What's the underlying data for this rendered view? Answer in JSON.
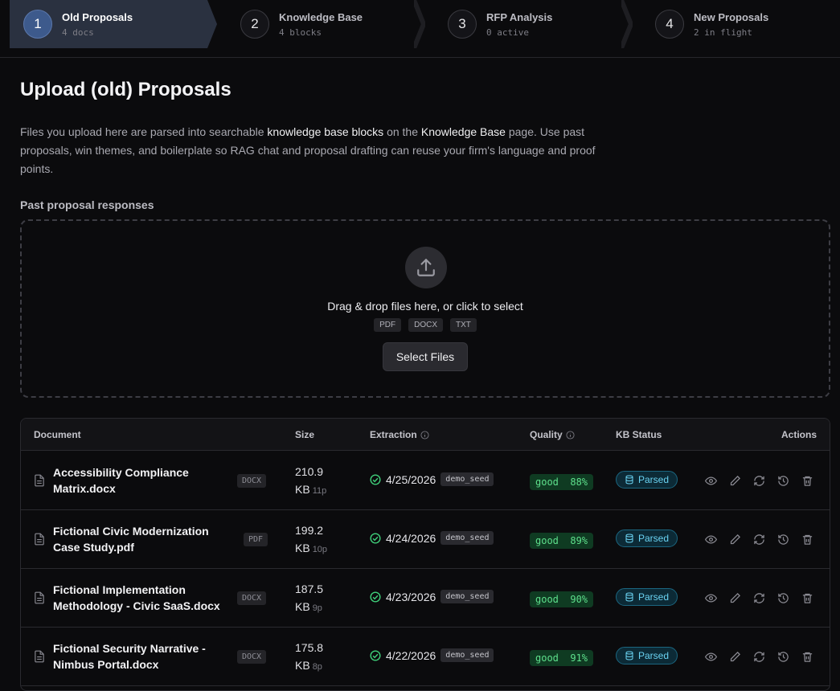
{
  "steps": [
    {
      "num": "1",
      "title": "Old Proposals",
      "sub": "4 docs"
    },
    {
      "num": "2",
      "title": "Knowledge Base",
      "sub": "4 blocks"
    },
    {
      "num": "3",
      "title": "RFP Analysis",
      "sub": "0 active"
    },
    {
      "num": "4",
      "title": "New Proposals",
      "sub": "2 in flight"
    }
  ],
  "page": {
    "title": "Upload (old) Proposals",
    "desc_1": "Files you upload here are parsed into searchable ",
    "desc_b1": "knowledge base blocks",
    "desc_2": " on the ",
    "desc_b2": "Knowledge Base",
    "desc_3": " page. Use past proposals, win themes, and boilerplate so RAG chat and proposal drafting can reuse your firm's language and proof points.",
    "section_label": "Past proposal responses"
  },
  "dropzone": {
    "title": "Drag & drop files here, or click to select",
    "types": [
      "PDF",
      "DOCX",
      "TXT"
    ],
    "button": "Select Files"
  },
  "table": {
    "headers": {
      "document": "Document",
      "size": "Size",
      "extraction": "Extraction",
      "quality": "Quality",
      "kb_status": "KB Status",
      "actions": "Actions"
    },
    "rows": [
      {
        "name": "Accessibility Compliance Matrix.docx",
        "type": "DOCX",
        "size": "210.9",
        "unit": "KB",
        "pages": "11p",
        "date": "4/25/2026",
        "seed": "demo_seed",
        "quality": "good  88%",
        "status": "Parsed"
      },
      {
        "name": "Fictional Civic Modernization Case Study.pdf",
        "type": "PDF",
        "size": "199.2",
        "unit": "KB",
        "pages": "10p",
        "date": "4/24/2026",
        "seed": "demo_seed",
        "quality": "good  89%",
        "status": "Parsed"
      },
      {
        "name": "Fictional Implementation Methodology - Civic SaaS.docx",
        "type": "DOCX",
        "size": "187.5",
        "unit": "KB",
        "pages": "9p",
        "date": "4/23/2026",
        "seed": "demo_seed",
        "quality": "good  90%",
        "status": "Parsed"
      },
      {
        "name": "Fictional Security Narrative - Nimbus Portal.docx",
        "type": "DOCX",
        "size": "175.8",
        "unit": "KB",
        "pages": "8p",
        "date": "4/22/2026",
        "seed": "demo_seed",
        "quality": "good  91%",
        "status": "Parsed"
      }
    ]
  },
  "colors": {
    "accent": "#3d5a8c",
    "success": "#5ee08c",
    "info": "#6ad3f2"
  }
}
